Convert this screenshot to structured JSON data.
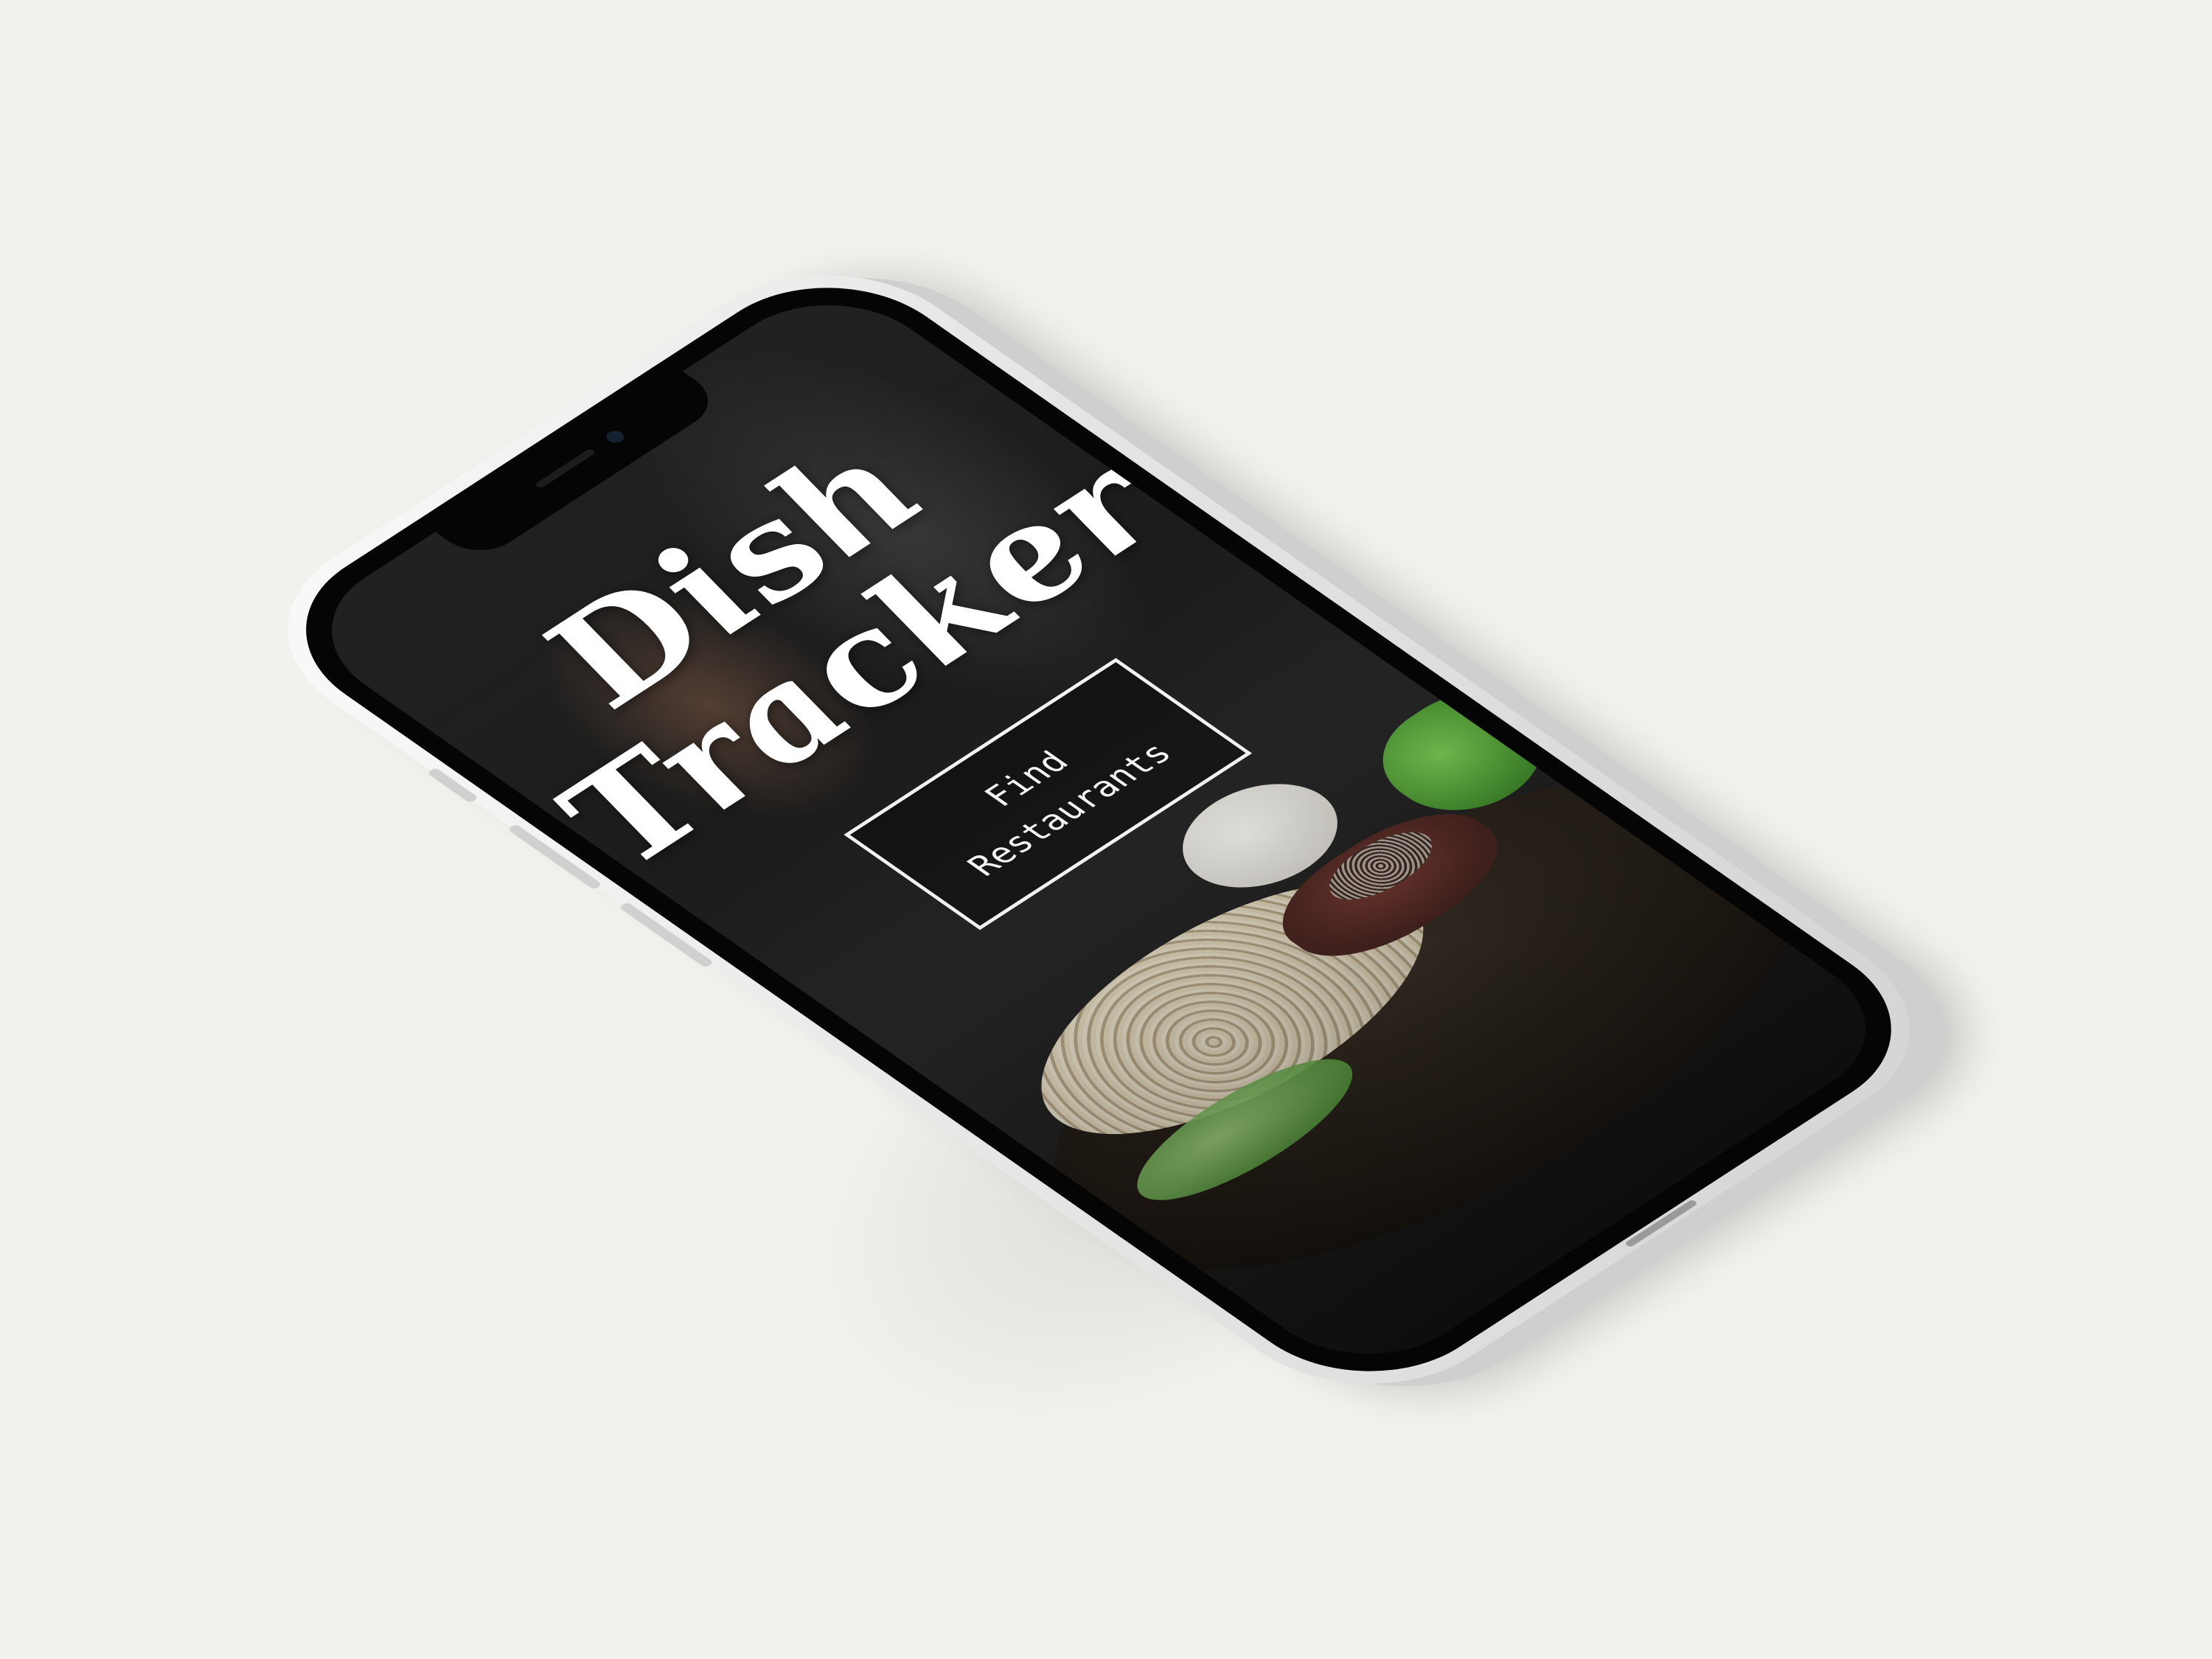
{
  "app": {
    "title_line_1": "Dish",
    "title_line_2": "Tracker"
  },
  "cta": {
    "line_1": "Find",
    "line_2": "Restaurants"
  },
  "colors": {
    "background": "#f1f2ee",
    "phone_frame": "#e6e6e6",
    "screen_overlay": "#1a1a1a",
    "text": "#ffffff"
  },
  "device": "smartphone-mockup"
}
